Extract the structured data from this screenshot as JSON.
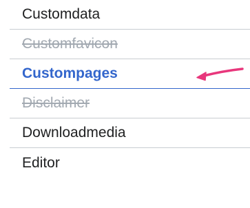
{
  "menu": {
    "items": [
      {
        "label": "Customdata",
        "state": "normal"
      },
      {
        "label": "Customfavicon",
        "state": "disabled"
      },
      {
        "label": "Custompages",
        "state": "active"
      },
      {
        "label": "Disclaimer",
        "state": "disabled"
      },
      {
        "label": "Downloadmedia",
        "state": "normal"
      },
      {
        "label": "Editor",
        "state": "normal"
      }
    ]
  },
  "annotation": {
    "arrow_color": "#e8377c",
    "icon": "arrow-pointer-icon"
  },
  "colors": {
    "active": "#3366cc",
    "disabled": "#a2a9b1",
    "text": "#202122",
    "divider": "#c8ccd1"
  }
}
